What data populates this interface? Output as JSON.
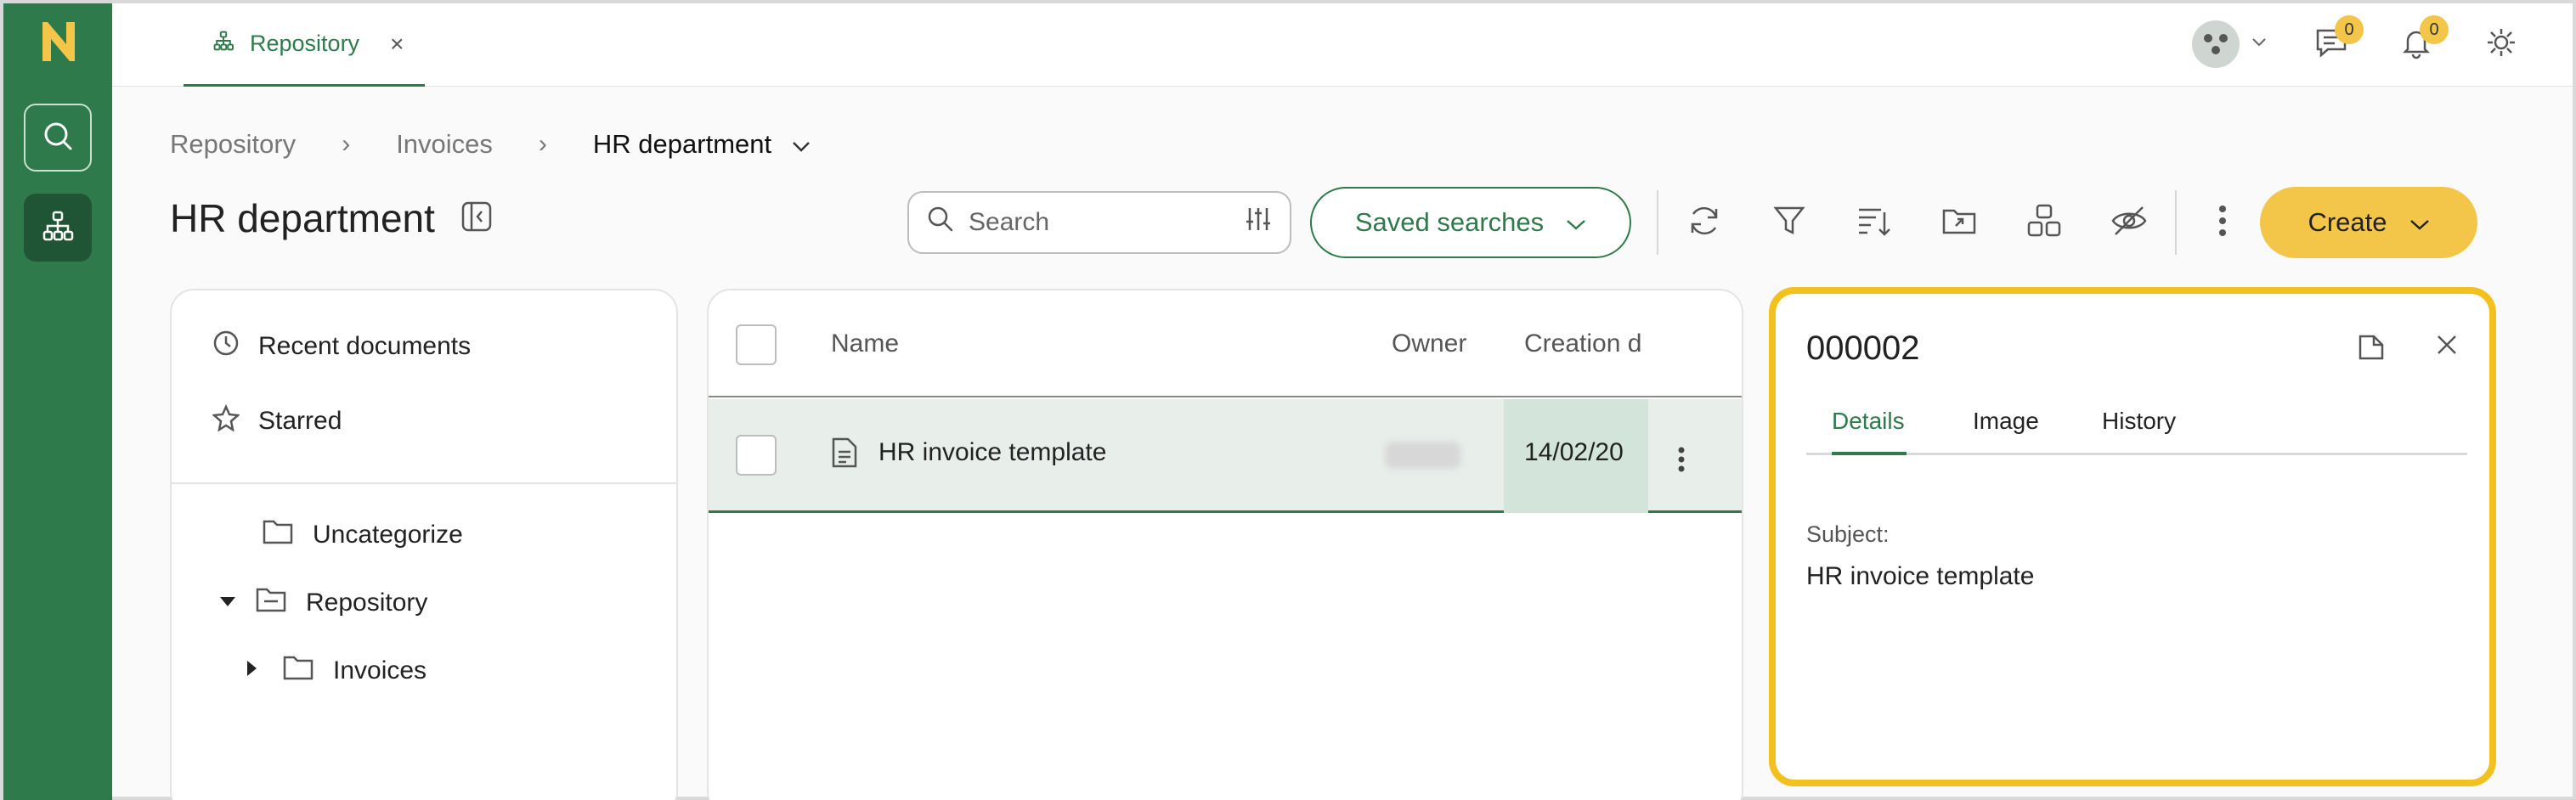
{
  "rail": {
    "logo": "n-logo",
    "items": [
      {
        "name": "search-icon"
      },
      {
        "name": "repository-tree-icon"
      }
    ]
  },
  "topbar": {
    "tab_label": "Repository",
    "tab_close": "×",
    "messages_count": "0",
    "notifications_count": "0"
  },
  "breadcrumb": {
    "items": [
      "Repository",
      "Invoices",
      "HR department"
    ],
    "separator": "›"
  },
  "page": {
    "title": "HR department"
  },
  "toolbar": {
    "search_placeholder": "Search",
    "saved_searches_label": "Saved searches",
    "create_label": "Create"
  },
  "tree": {
    "recent_label": "Recent documents",
    "starred_label": "Starred",
    "folders": [
      {
        "label": "Uncategorize"
      },
      {
        "label": "Repository"
      },
      {
        "label": "Invoices"
      }
    ]
  },
  "table": {
    "columns": [
      "Name",
      "Owner",
      "Creation d"
    ],
    "rows": [
      {
        "name": "HR invoice template",
        "owner": "",
        "created": "14/02/20"
      }
    ]
  },
  "detail": {
    "id": "000002",
    "tabs": [
      "Details",
      "Image",
      "History"
    ],
    "active_tab": "Details",
    "subject_label": "Subject:",
    "subject_value": "HR invoice template"
  },
  "colors": {
    "brand_green": "#2f7a4a",
    "accent_yellow": "#f3c64a",
    "highlight_border": "#f3c11f"
  }
}
